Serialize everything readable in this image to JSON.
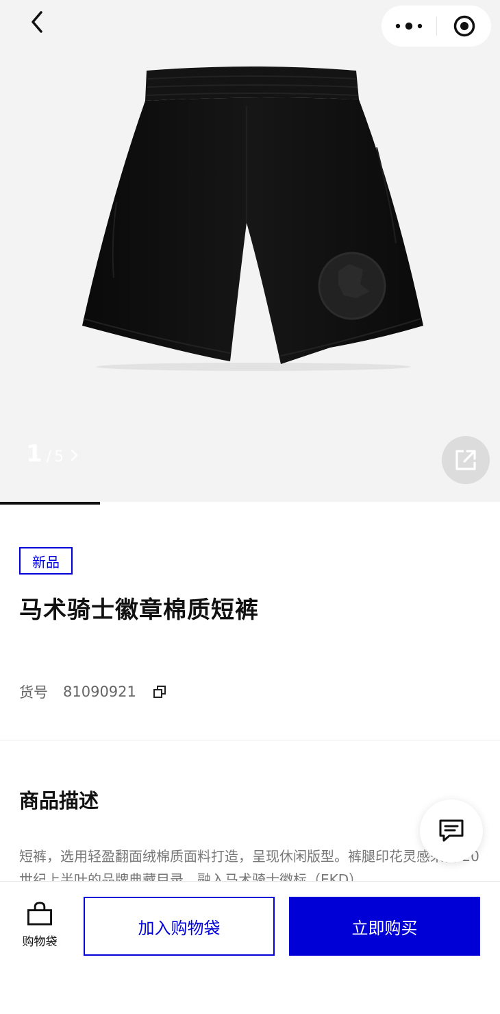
{
  "gallery": {
    "current": "1",
    "separator": "/",
    "total": "5",
    "progress_fraction": 0.2
  },
  "product": {
    "badge": "新品",
    "title": "马术骑士徽章棉质短裤",
    "sku_label": "货号",
    "sku_value": "81090921"
  },
  "description": {
    "heading": "商品描述",
    "text": "短裤，选用轻盈翻面绒棉质面料打造，呈现休闲版型。裤腿印花灵感来自 20 世纪上半叶的品牌典藏目录，融入马术骑士徽标（EKD）"
  },
  "bottom_bar": {
    "bag_label": "购物袋",
    "add_to_bag": "加入购物袋",
    "buy_now": "立即购买"
  },
  "colors": {
    "accent": "#0000d6",
    "gallery_bg": "#f3f3f3",
    "product": "#0d0d0d"
  },
  "icons": [
    "back-icon",
    "more-icon",
    "close-mini-program-icon",
    "next-chevron-icon",
    "share-icon",
    "copy-icon",
    "chat-icon",
    "shopping-bag-icon"
  ]
}
